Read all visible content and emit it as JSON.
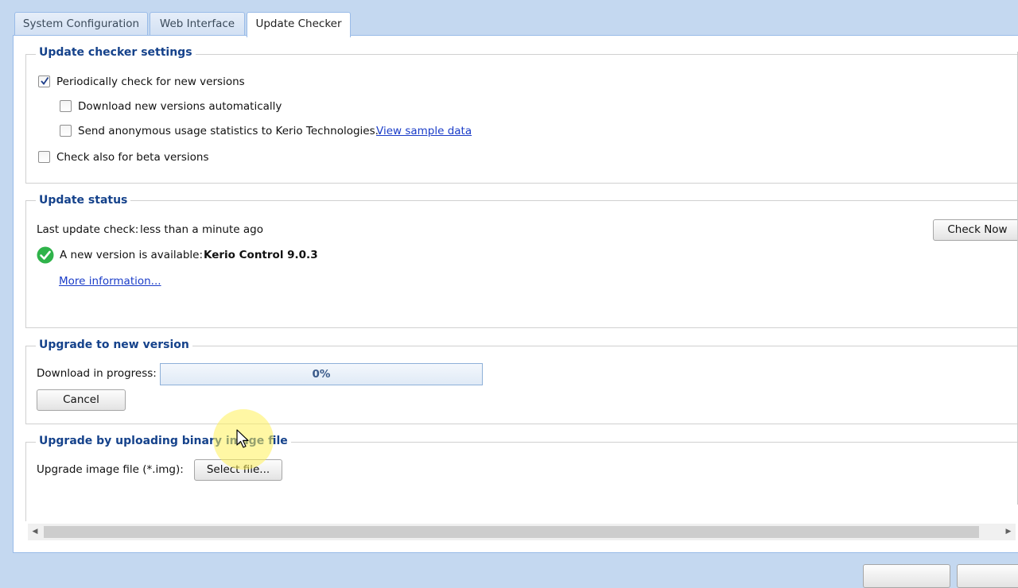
{
  "tabs": [
    {
      "label": "System Configuration",
      "active": false
    },
    {
      "label": "Web Interface",
      "active": false
    },
    {
      "label": "Update Checker",
      "active": true
    }
  ],
  "update_checker_settings": {
    "legend": "Update checker settings",
    "periodic_label": "Periodically check for new versions",
    "periodic_checked": true,
    "download_auto_label": "Download new versions automatically",
    "download_auto_checked": false,
    "send_stats_label": "Send anonymous usage statistics to Kerio Technologies.",
    "send_stats_checked": false,
    "view_sample_link": "View sample data",
    "beta_label": "Check also for beta versions",
    "beta_checked": false
  },
  "update_status": {
    "legend": "Update status",
    "last_check_label": "Last update check:",
    "last_check_value": "less than a minute ago",
    "check_now_button": "Check Now",
    "new_version_text": "A new version is available:",
    "new_version_name": "Kerio Control 9.0.3",
    "more_info_link": "More information..."
  },
  "upgrade": {
    "legend": "Upgrade to new version",
    "download_label": "Download in progress:",
    "progress_text": "0%",
    "progress_value": 0,
    "cancel_button": "Cancel"
  },
  "upload": {
    "legend": "Upgrade by uploading binary image file",
    "file_label": "Upgrade image file (*.img):",
    "select_button": "Select file..."
  },
  "colors": {
    "accent": "#15428b",
    "link": "#1a3cc8",
    "success": "#2fb34a",
    "frame": "#c4d8f0"
  }
}
